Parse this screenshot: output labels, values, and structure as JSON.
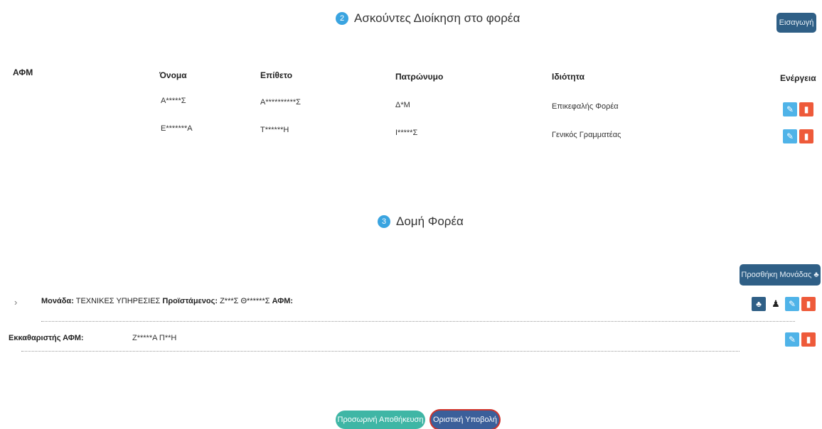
{
  "section2": {
    "number": "2",
    "title": "Ασκούντες Διοίκηση στο φορέα",
    "import_label": "Εισαγωγή"
  },
  "table": {
    "headers": [
      "ΑΦΜ",
      "Όνομα",
      "Επίθετο",
      "Πατρώνυμο",
      "Ιδιότητα",
      "Ενέργεια"
    ],
    "rows": [
      {
        "afm": "",
        "first": "Α*****Σ",
        "last": "Α**********Σ",
        "father": "Δ*Μ",
        "role": "Επικεφαλής Φορέα"
      },
      {
        "afm": "",
        "first": "Ε*******Α",
        "last": "Τ******Η",
        "father": "Ι*****Σ",
        "role": "Γενικός Γραμματέας"
      }
    ]
  },
  "section3": {
    "number": "3",
    "title": "Δομή Φορέα",
    "add_unit_label": "Προσθήκη Μονάδας ♣"
  },
  "unit": {
    "expand_icon": "chevron-right",
    "label_prefix": "Μονάδα:",
    "name": "ΤΕΧΝΙΚΕΣ ΥΠΗΡΕΣΙΕΣ",
    "head_label": "Προϊστάμενος:",
    "head_name": "Ζ***Σ Θ******Σ",
    "afm_label": "ΑΦΜ:"
  },
  "liquidator": {
    "label": "Εκκαθαριστής ΑΦΜ:",
    "name": "Ζ*****Α Π**Η"
  },
  "footer": {
    "temp_save_label": "Προσωρινή Αποθήκευση",
    "final_submit_label": "Οριστική Υποβολή"
  },
  "colors": {
    "accent": "#3aa4e0",
    "dark_button": "#2f5f86",
    "edit": "#4fb3e8",
    "delete": "#ee5a3a",
    "temp_save": "#3fb6a5",
    "final_submit": "#3b5f9a",
    "highlight_ring": "#d0342c"
  }
}
